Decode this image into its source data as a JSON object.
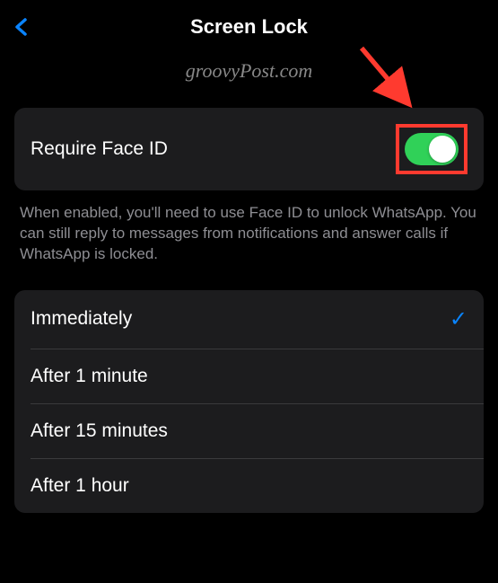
{
  "header": {
    "title": "Screen Lock"
  },
  "watermark": "groovyPost.com",
  "faceId": {
    "label": "Require Face ID",
    "enabled": true,
    "description": "When enabled, you'll need to use Face ID to unlock WhatsApp. You can still reply to messages from notifications and answer calls if WhatsApp is locked."
  },
  "timeOptions": [
    {
      "label": "Immediately",
      "selected": true
    },
    {
      "label": "After 1 minute",
      "selected": false
    },
    {
      "label": "After 15 minutes",
      "selected": false
    },
    {
      "label": "After 1 hour",
      "selected": false
    }
  ],
  "colors": {
    "accent": "#0a84ff",
    "toggleOn": "#30d158",
    "highlight": "#ff3a2f"
  }
}
